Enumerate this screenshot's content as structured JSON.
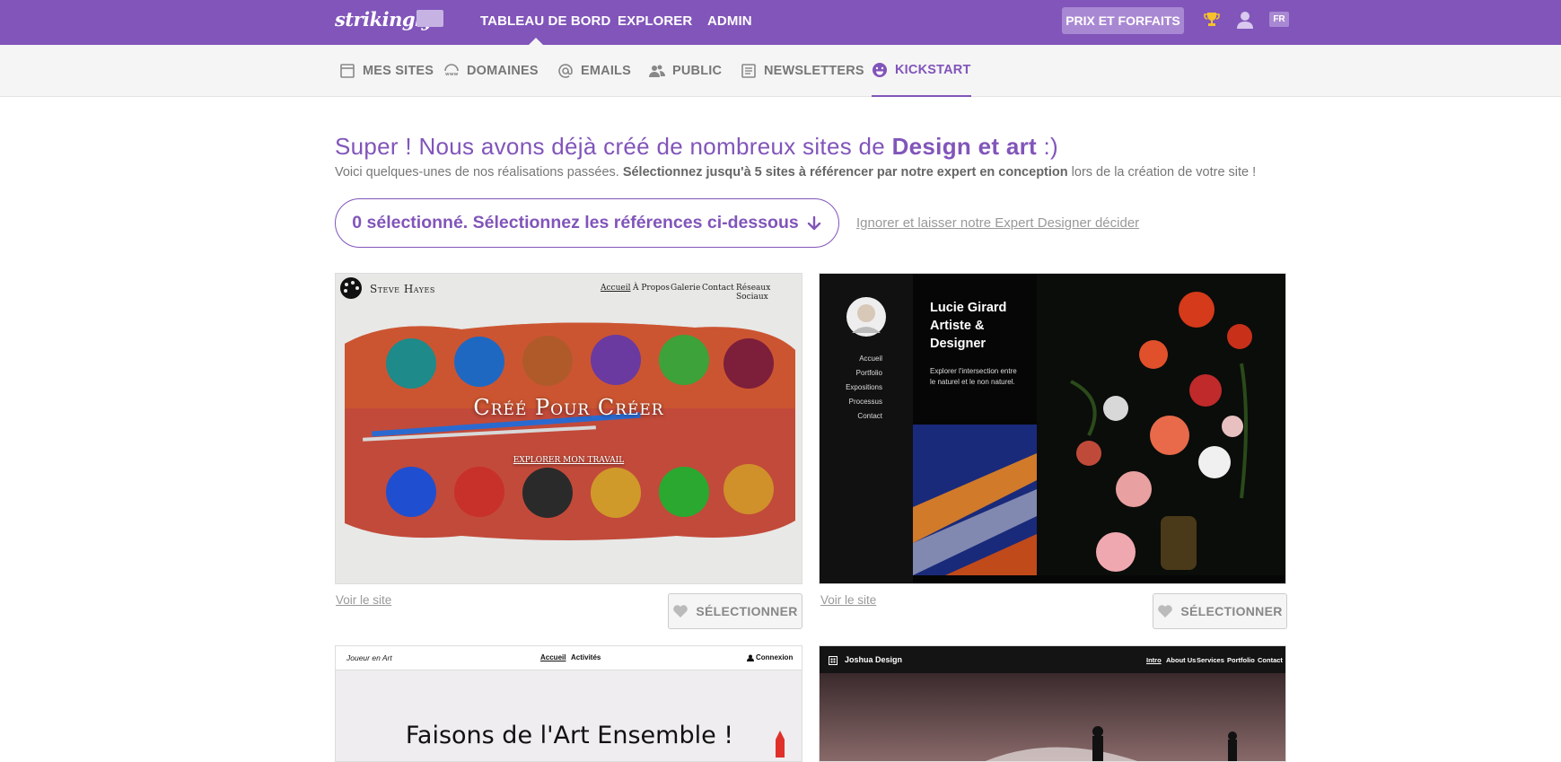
{
  "topbar": {
    "logo": "strikingly",
    "nav": [
      "TABLEAU DE BORD",
      "EXPLORER",
      "ADMIN"
    ],
    "plans_button": "PRIX ET FORFAITS",
    "lang": "FR"
  },
  "subnav": {
    "tabs": [
      {
        "label": "MES SITES",
        "icon": "sites-icon"
      },
      {
        "label": "DOMAINES",
        "icon": "domains-icon"
      },
      {
        "label": "EMAILS",
        "icon": "at-icon"
      },
      {
        "label": "PUBLIC",
        "icon": "users-icon"
      },
      {
        "label": "NEWSLETTERS",
        "icon": "newsletter-icon"
      },
      {
        "label": "KICKSTART",
        "icon": "smiley-icon",
        "active": true
      }
    ]
  },
  "main": {
    "heading_prefix": "Super ! Nous avons déjà créé de nombreux sites de ",
    "heading_category": "Design et art",
    "heading_suffix": " :)",
    "sub_prefix": "Voici quelques-unes de nos réalisations passées. ",
    "sub_bold": "Sélectionnez jusqu'à 5 sites à référencer par notre expert en conception",
    "sub_suffix": " lors de la création de votre site !",
    "selection_pill": "0 sélectionné. Sélectionnez les références ci-dessous",
    "ignore_link": "Ignorer et laisser notre Expert Designer décider"
  },
  "cards": [
    {
      "brand": "Steve Hayes",
      "nav": [
        "Accueil",
        "À Propos",
        "Galerie",
        "Contact",
        "Réseaux Sociaux"
      ],
      "hero": "Créé Pour Créer",
      "cta": "EXPLORER MON TRAVAIL",
      "view_link": "Voir le site",
      "select_label": "SÉLECTIONNER"
    },
    {
      "title_lines": [
        "Lucie Girard",
        "Artiste &",
        "Designer"
      ],
      "desc": "Explorer l'intersection entre le naturel et le non naturel.",
      "nav": [
        "Accueil",
        "Portfolio",
        "Expositions",
        "Processus",
        "Contact"
      ],
      "view_link": "Voir le site",
      "select_label": "SÉLECTIONNER"
    },
    {
      "brand": "Joueur en Art",
      "nav": [
        "Accueil",
        "Activités"
      ],
      "login": "Connexion",
      "hero": "Faisons de l'Art Ensemble !"
    },
    {
      "brand": "Joshua Design",
      "nav": [
        "Intro",
        "About Us",
        "Services",
        "Portfolio",
        "Contact"
      ]
    }
  ],
  "colors": {
    "brand_purple": "#8155ba",
    "plans_button": "#a988d3"
  }
}
